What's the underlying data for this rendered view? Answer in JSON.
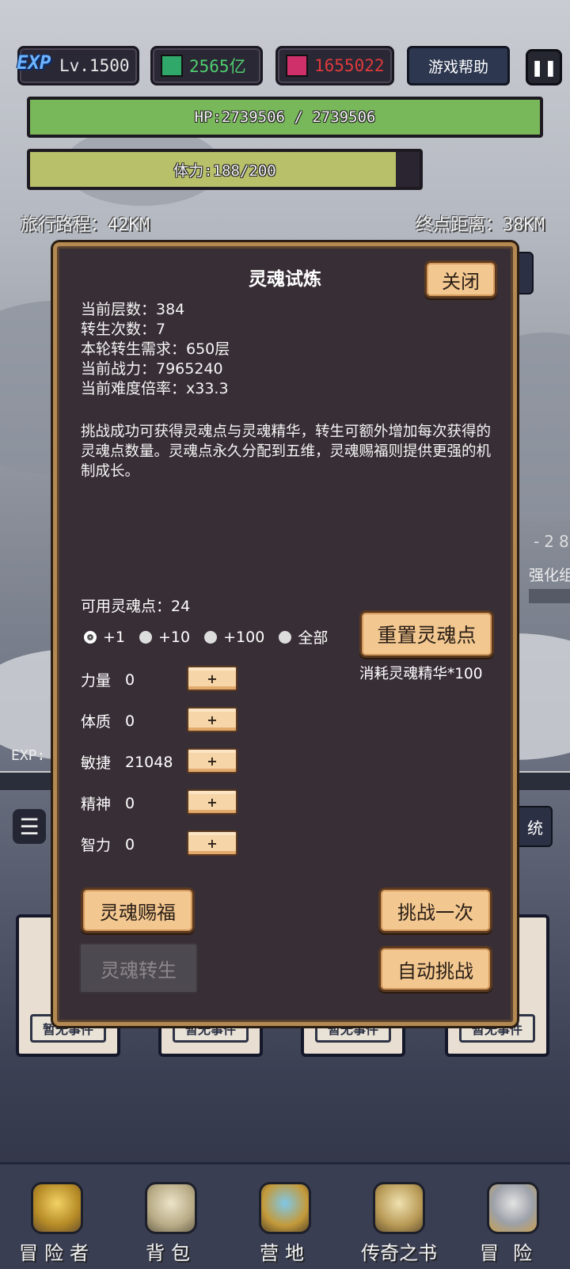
{
  "topbar": {
    "exp_badge": "EXP",
    "level": "Lv.1500",
    "green_currency": "2565亿",
    "red_currency": "1655022",
    "help_label": "游戏帮助",
    "pause_icon": "pause-icon"
  },
  "hp_bar": {
    "text": "HP:2739506 / 2739506",
    "fill": 1.0,
    "color": "#78b85a"
  },
  "stamina_bar": {
    "text": "体力:188/200",
    "fill": 0.94,
    "color": "#b9c06a"
  },
  "travel": {
    "distance": "旅行路程：42KM",
    "remaining": "终点距离：38KM"
  },
  "background": {
    "damage_hint": "-28",
    "upgrade_hint": "强化组",
    "system_hint": "统",
    "exp_hint": "EXP:"
  },
  "modal": {
    "title": "灵魂试炼",
    "close_label": "关闭",
    "stats": [
      "当前层数：384",
      "转生次数：7",
      "本轮转生需求：650层",
      "当前战力：7965240",
      "当前难度倍率：x33.3"
    ],
    "description": "挑战成功可获得灵魂点与灵魂精华，转生可额外增加每次获得的灵魂点数量。灵魂点永久分配到五维，灵魂赐福则提供更强的机制成长。",
    "available_points": "可用灵魂点：24",
    "radio_options": [
      "+1",
      "+10",
      "+100",
      "全部"
    ],
    "selected_option": "+1",
    "reset_label": "重置灵魂点",
    "reset_cost": "消耗灵魂精华*100",
    "attributes": [
      {
        "name": "力量",
        "value": "0"
      },
      {
        "name": "体质",
        "value": "0"
      },
      {
        "name": "敏捷",
        "value": "21048"
      },
      {
        "name": "精神",
        "value": "0"
      },
      {
        "name": "智力",
        "value": "0"
      }
    ],
    "plus_label": "+",
    "blessing_label": "灵魂赐福",
    "rebirth_label": "灵魂转生",
    "challenge_once_label": "挑战一次",
    "auto_challenge_label": "自动挑战"
  },
  "event_cards": [
    "暂无事件",
    "暂无事件",
    "暂无事件",
    "暂无事件"
  ],
  "nav": [
    {
      "label": "冒险者",
      "icon": "crown-helmet-icon"
    },
    {
      "label": "背包",
      "icon": "backpack-icon"
    },
    {
      "label": "营地",
      "icon": "banner-icon"
    },
    {
      "label": "传奇之书",
      "icon": "book-icon"
    },
    {
      "label": "冒险",
      "icon": "sword-icon"
    }
  ]
}
